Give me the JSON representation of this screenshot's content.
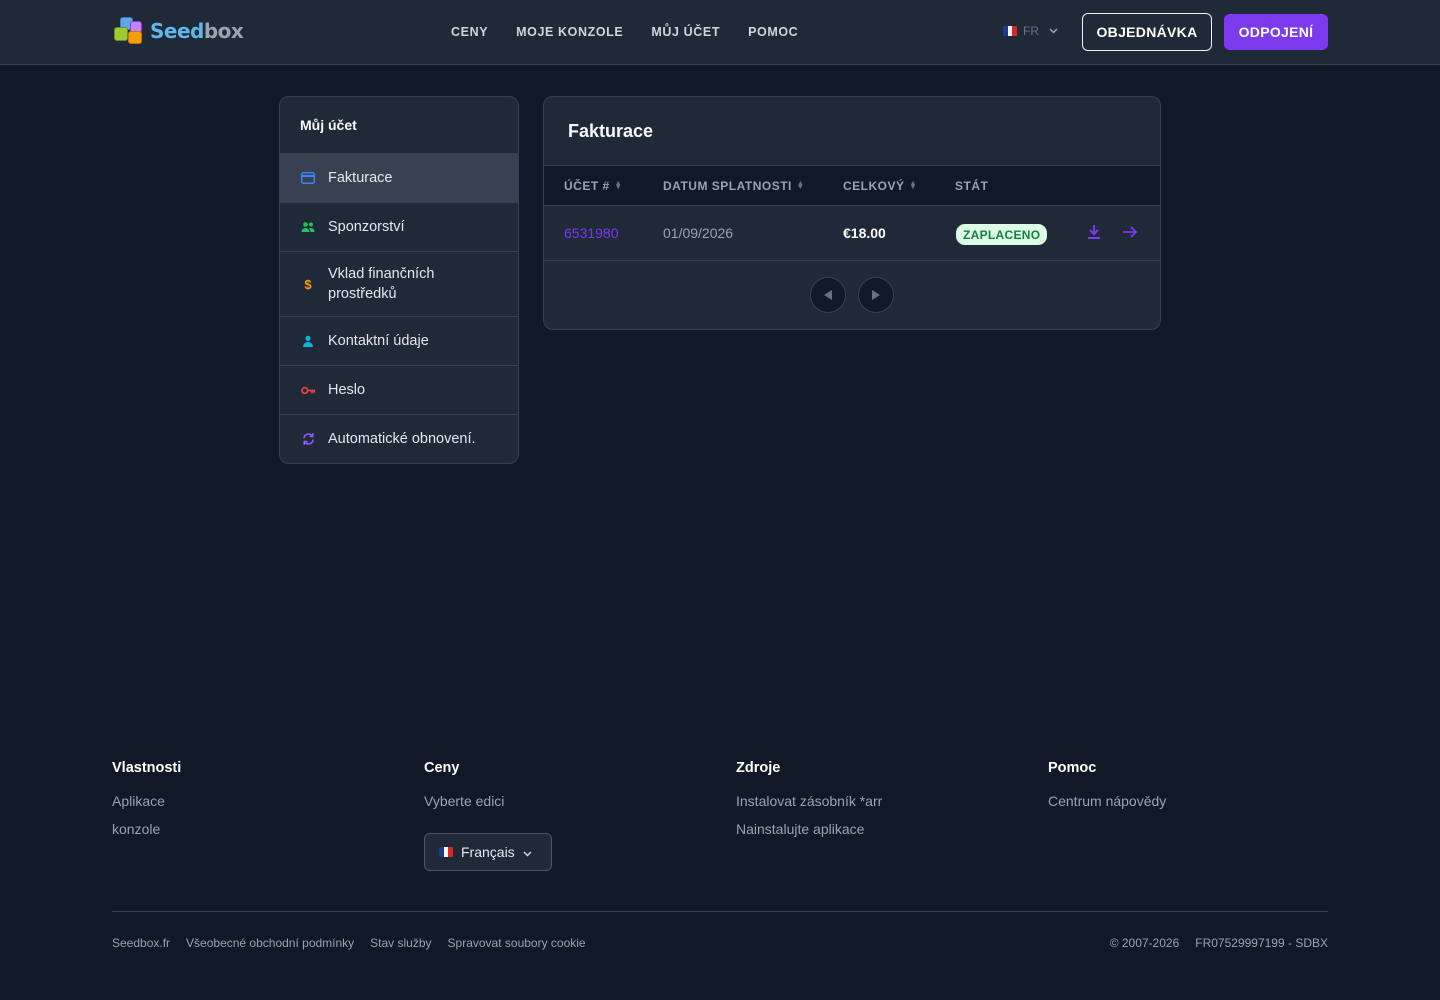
{
  "header": {
    "logo_text_a": "Seed",
    "logo_text_b": "box",
    "nav": [
      "CENY",
      "MOJE KONZOLE",
      "MŮJ ÚČET",
      "POMOC"
    ],
    "lang_code": "FR",
    "order_button": "OBJEDNÁVKA",
    "logout_button": "ODPOJENÍ"
  },
  "sidebar": {
    "title": "Můj účet",
    "items": [
      {
        "label": "Fakturace",
        "icon": "credit-card-icon",
        "color": "#3b82f6",
        "active": true
      },
      {
        "label": "Sponzorství",
        "icon": "users-icon",
        "color": "#22c55e"
      },
      {
        "label": "Vklad finančních prostředků",
        "icon": "dollar-icon",
        "color": "#f59e0b"
      },
      {
        "label": "Kontaktní údaje",
        "icon": "user-icon",
        "color": "#06b6d4"
      },
      {
        "label": "Heslo",
        "icon": "key-icon",
        "color": "#ef4444"
      },
      {
        "label": "Automatické obnovení.",
        "icon": "refresh-icon",
        "color": "#8b5cf6"
      }
    ]
  },
  "invoices": {
    "title": "Fakturace",
    "columns": [
      "ÚČET #",
      "DATUM SPLATNOSTI",
      "CELKOVÝ",
      "STÁT"
    ],
    "rows": [
      {
        "invoice": "6531980",
        "due": "01/09/2026",
        "total": "€18.00",
        "status": "ZAPLACENO"
      }
    ]
  },
  "footer": {
    "cols": [
      {
        "head": "Vlastnosti",
        "links": [
          "Aplikace",
          "konzole"
        ]
      },
      {
        "head": "Ceny",
        "links": [
          "Vyberte edici"
        ]
      },
      {
        "head": "Zdroje",
        "links": [
          "Instalovat zásobník *arr",
          "Nainstalujte aplikace"
        ]
      },
      {
        "head": "Pomoc",
        "links": [
          "Centrum nápovědy"
        ]
      }
    ],
    "language_select": "Français",
    "bottom_links": [
      "Seedbox.fr",
      "Všeobecné obchodní podmínky",
      "Stav služby",
      "Spravovat soubory cookie"
    ],
    "copyright": "© 2007-2026",
    "company_id": "FR07529997199 - SDBX"
  },
  "colors": {
    "accent": "#7c3aed",
    "background": "#111827",
    "panel": "#1f2937",
    "paid_badge": "#dcfce7"
  }
}
